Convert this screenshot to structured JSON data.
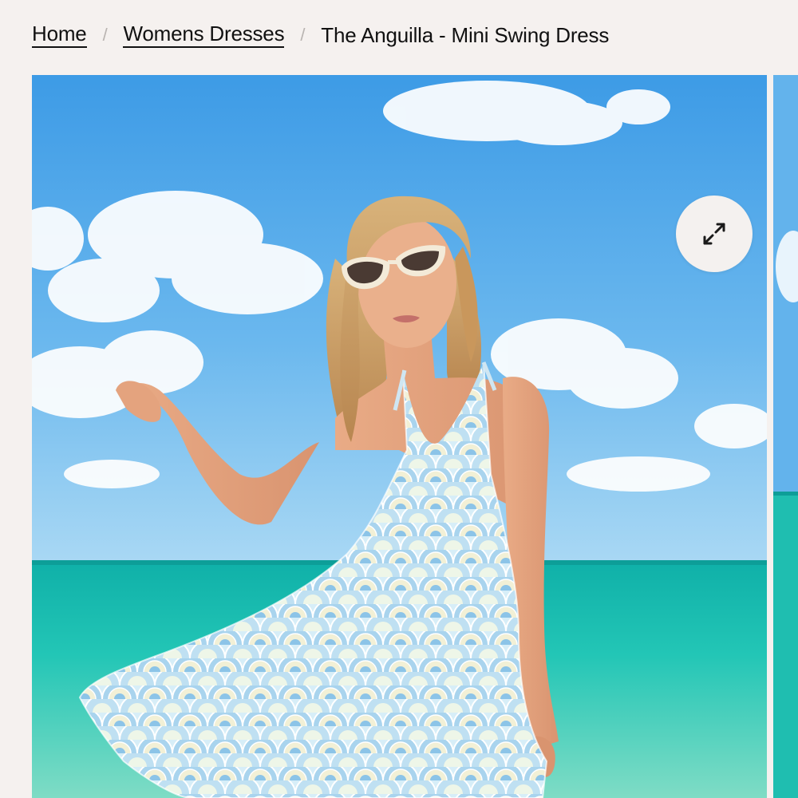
{
  "breadcrumb": {
    "items": [
      {
        "label": "Home"
      },
      {
        "label": "Womens Dresses"
      },
      {
        "label": "The Anguilla - Mini Swing Dress"
      }
    ],
    "separator": "/"
  },
  "gallery": {
    "zoom_icon": "expand-arrows-icon"
  },
  "colors": {
    "page_background": "#f5f1ef",
    "sky": "#4aa6ea",
    "sea": "#1fc2b0",
    "dress": "#bfe0f2"
  }
}
